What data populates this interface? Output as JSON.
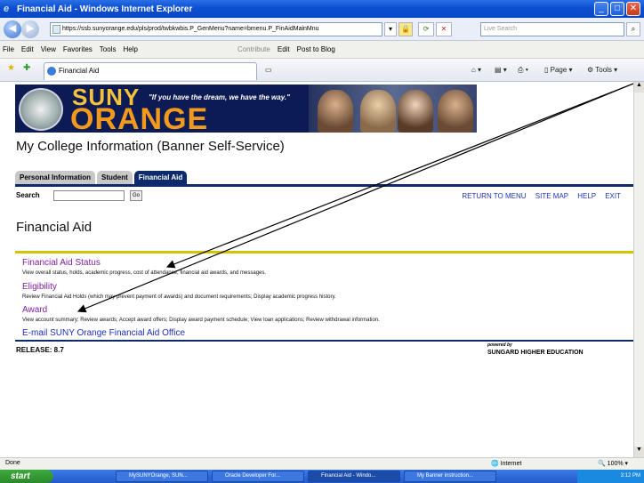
{
  "window": {
    "title": "Financial Aid - Windows Internet Explorer"
  },
  "address": {
    "url": "https://ssb.sunyorange.edu/pls/prod/twbkwbis.P_GenMenu?name=bmenu.P_FinAidMainMnu",
    "search_placeholder": "Live Search"
  },
  "menu": {
    "file": "File",
    "edit": "Edit",
    "view": "View",
    "favorites": "Favorites",
    "tools": "Tools",
    "help": "Help",
    "contribute": "Contribute",
    "edit_btn": "Edit",
    "post_blog": "Post to Blog"
  },
  "browser_tab": {
    "label": "Financial Aid",
    "page": "Page",
    "tools": "Tools"
  },
  "banner": {
    "suny": "SUNY",
    "orange": "ORANGE",
    "tagline": "\"If you have the dream, we have the way.\""
  },
  "page": {
    "title": "My College Information (Banner Self-Service)"
  },
  "nav_tabs": [
    "Personal Information",
    "Student",
    "Financial Aid"
  ],
  "search": {
    "label": "Search",
    "go": "Go"
  },
  "top_links": [
    "RETURN TO MENU",
    "SITE MAP",
    "HELP",
    "EXIT"
  ],
  "heading": "Financial Aid",
  "items": [
    {
      "link": "Financial Aid Status",
      "desc": "View overall status, holds, academic progress, cost of attendance, financial aid awards, and messages."
    },
    {
      "link": "Eligibility",
      "desc": "Review Financial Aid Holds (which may prevent payment of awards) and document requirements; Display academic progress history."
    },
    {
      "link": "Award",
      "desc": "View account summary; Review awards; Accept award offers; Display award payment schedule; View loan applications; Review withdrawal information."
    },
    {
      "link": "E-mail SUNY Orange Financial Aid Office",
      "desc": ""
    }
  ],
  "footer": {
    "release": "RELEASE: 8.7",
    "powered": "powered by",
    "sungard": "SUNGARD HIGHER EDUCATION"
  },
  "status": {
    "left": "Done",
    "zone": "Internet",
    "zoom": "100%"
  },
  "taskbar": {
    "start": "start",
    "buttons": [
      "MySUNYOrange, SUN...",
      "Oracle Developer For...",
      "Financial Aid - Windo...",
      "My Banner instruction..."
    ],
    "time": "3:12 PM"
  }
}
